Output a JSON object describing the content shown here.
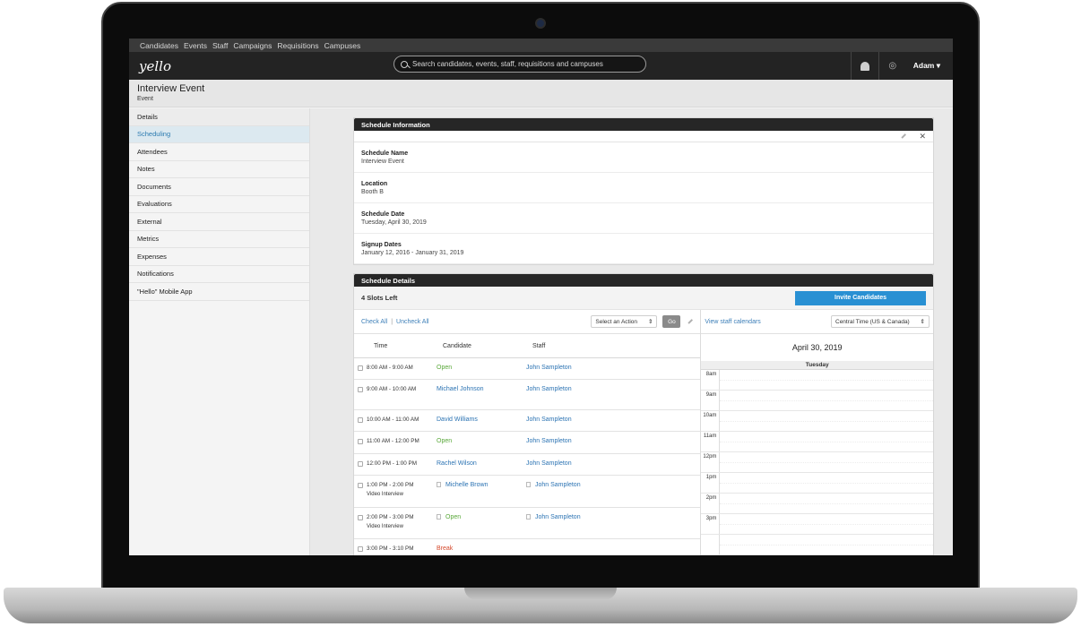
{
  "nav": [
    "Candidates",
    "Events",
    "Staff",
    "Campaigns",
    "Requisitions",
    "Campuses"
  ],
  "logo": "yello",
  "search": {
    "placeholder": "Search candidates, events, staff, requisitions and campuses"
  },
  "user": "Adam",
  "page": {
    "title": "Interview Event",
    "subtitle": "Event"
  },
  "sidebar": [
    {
      "label": "Details",
      "active": false
    },
    {
      "label": "Scheduling",
      "active": true
    },
    {
      "label": "Attendees",
      "active": false
    },
    {
      "label": "Notes",
      "active": false
    },
    {
      "label": "Documents",
      "active": false
    },
    {
      "label": "Evaluations",
      "active": false
    },
    {
      "label": "External",
      "active": false
    },
    {
      "label": "Metrics",
      "active": false
    },
    {
      "label": "Expenses",
      "active": false
    },
    {
      "label": "Notifications",
      "active": false
    },
    {
      "label": "\"Hello\" Mobile App",
      "active": false
    }
  ],
  "schedule_info": {
    "heading": "Schedule Information",
    "fields": [
      {
        "label": "Schedule Name",
        "value": "Interview Event"
      },
      {
        "label": "Location",
        "value": "Booth B"
      },
      {
        "label": "Schedule Date",
        "value": "Tuesday, April 30, 2019"
      },
      {
        "label": "Signup Dates",
        "value": "January 12, 2016 - January 31, 2019"
      }
    ]
  },
  "schedule_details": {
    "heading": "Schedule Details",
    "slots_left": "4 Slots Left",
    "invite_label": "Invite Candidates",
    "check_all": "Check All",
    "uncheck_all": "Uncheck All",
    "action_select": "Select an Action",
    "go_label": "Go",
    "staff_calendars_link": "View staff calendars",
    "timezone": "Central Time (US & Canada)",
    "columns": [
      "Time",
      "Candidate",
      "Staff"
    ],
    "rows": [
      {
        "time": "8:00 AM - 9:00 AM",
        "candidate": "Open",
        "candidate_type": "open",
        "staff": "John Sampleton",
        "sub": "",
        "cal": false,
        "h": 24
      },
      {
        "time": "9:00 AM - 10:00 AM",
        "candidate": "Michael Johnson",
        "candidate_type": "blue",
        "staff": "John Sampleton",
        "sub": "",
        "cal": false,
        "h": 34
      },
      {
        "time": "10:00 AM - 11:00 AM",
        "candidate": "David Williams",
        "candidate_type": "blue",
        "staff": "John Sampleton",
        "sub": "",
        "cal": false,
        "h": 24
      },
      {
        "time": "11:00 AM - 12:00 PM",
        "candidate": "Open",
        "candidate_type": "open",
        "staff": "John Sampleton",
        "sub": "",
        "cal": false,
        "h": 25
      },
      {
        "time": "12:00 PM - 1:00 PM",
        "candidate": "Rachel Wilson",
        "candidate_type": "blue",
        "staff": "John Sampleton",
        "sub": "",
        "cal": false,
        "h": 24
      },
      {
        "time": "1:00 PM - 2:00 PM",
        "candidate": "Michelle Brown",
        "candidate_type": "blue",
        "staff": "John Sampleton",
        "sub": "Video Interview",
        "cal": true,
        "h": 36
      },
      {
        "time": "2:00 PM - 3:00 PM",
        "candidate": "Open",
        "candidate_type": "open",
        "staff": "John Sampleton",
        "sub": "Video Interview",
        "cal": true,
        "h": 35
      },
      {
        "time": "3:00 PM - 3:10 PM",
        "candidate": "Break",
        "candidate_type": "red",
        "staff": "",
        "sub": "",
        "cal": false,
        "h": 24
      }
    ]
  },
  "calendar": {
    "date": "April 30, 2019",
    "day": "Tuesday",
    "hours": [
      "8am",
      "9am",
      "10am",
      "11am",
      "12pm",
      "1pm",
      "2pm",
      "3pm",
      ""
    ]
  }
}
